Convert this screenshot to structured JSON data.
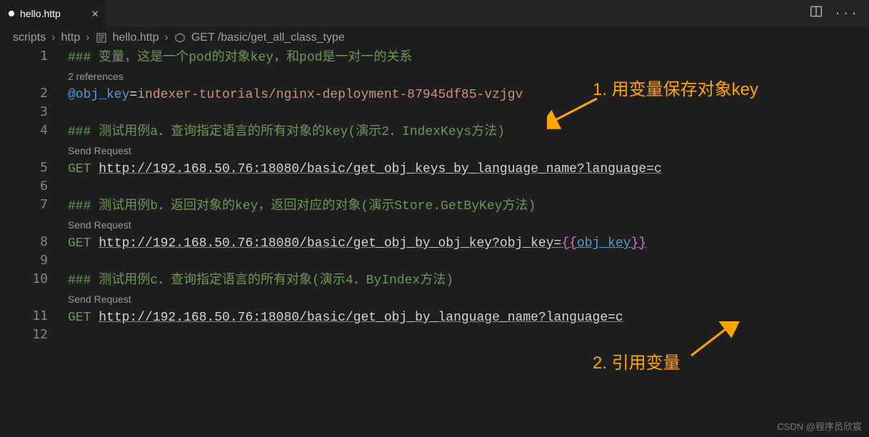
{
  "tab": {
    "filename": "hello.http",
    "modified": true
  },
  "breadcrumb": {
    "parts": [
      "scripts",
      "http",
      "hello.http",
      "GET /basic/get_all_class_type"
    ]
  },
  "editor": {
    "referencesLabel": "2 references",
    "sendRequestLabel": "Send Request",
    "lines": {
      "l1_comment": "### 变量，这是一个pod的对象key，和pod是一对一的关系",
      "l2_var": "@obj_key",
      "l2_op": "=",
      "l2_val": "indexer-tutorials/nginx-deployment-87945df85-vzjgv",
      "l4_comment": "### 测试用例a．查询指定语言的所有对象的key(演示2．IndexKeys方法)",
      "l5_method": "GET",
      "l5_url": "http://192.168.50.76:18080/basic/get_obj_keys_by_language_name?language=c",
      "l7_comment": "### 测试用例b．返回对象的key，返回对应的对象(演示Store.GetByKey方法)",
      "l8_method": "GET",
      "l8_url_prefix": "http://192.168.50.76:18080/basic/get_obj_by_obj_key?obj_key=",
      "l8_brace_open": "{{",
      "l8_varref": "obj_key",
      "l8_brace_close": "}}",
      "l10_comment": "### 测试用例c．查询指定语言的所有对象(演示4．ByIndex方法)",
      "l11_method": "GET",
      "l11_url": "http://192.168.50.76:18080/basic/get_obj_by_language_name?language=c"
    }
  },
  "annotations": {
    "a1": "1. 用变量保存对象key",
    "a2": "2. 引用变量"
  },
  "watermark": "CSDN @程序员欣宸"
}
